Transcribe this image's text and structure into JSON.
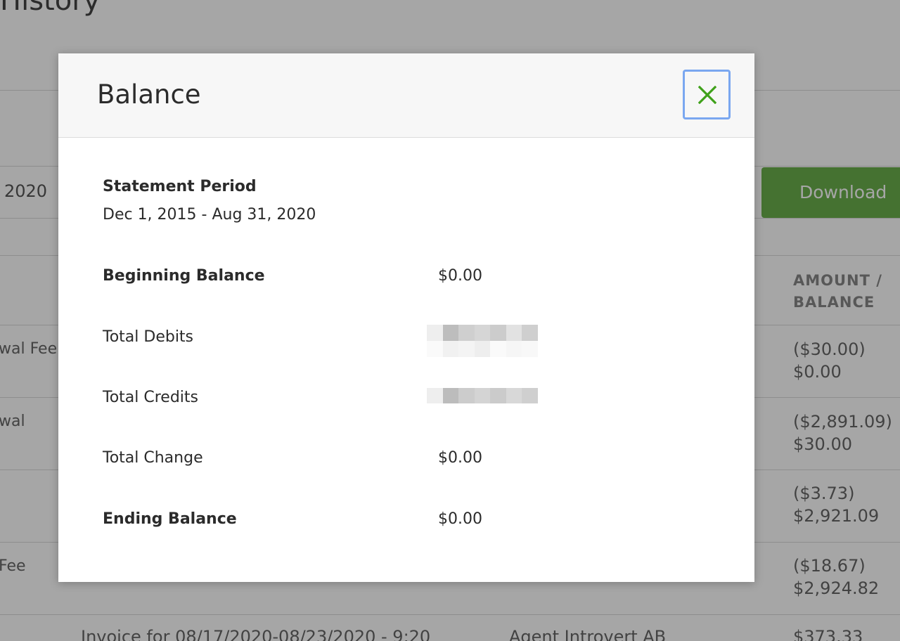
{
  "background": {
    "page_title": "History",
    "date_filter_text": "2020",
    "download_label": "Download",
    "column_header_amount": "AMOUNT /",
    "column_header_balance": "BALANCE",
    "rows": [
      {
        "left": "wal Fee",
        "amount": "($30.00)",
        "balance": "$0.00"
      },
      {
        "left": "wal",
        "amount": "($2,891.09)",
        "balance": "$30.00"
      },
      {
        "left": "",
        "amount": "($3.73)",
        "balance": "$2,921.09"
      },
      {
        "left": "Fee",
        "amount": "($18.67)",
        "balance": "$2,924.82"
      }
    ],
    "bottom_row": {
      "description": "Invoice for 08/17/2020-08/23/2020 - 9:20",
      "party": "Agent Introvert AB",
      "amount": "$373.33"
    }
  },
  "modal": {
    "title": "Balance",
    "close_icon": "close-icon",
    "statement_period_label": "Statement Period",
    "statement_period_value": "Dec 1, 2015 - Aug 31, 2020",
    "beginning_balance_label": "Beginning Balance",
    "beginning_balance_value": "$0.00",
    "total_debits_label": "Total Debits",
    "total_credits_label": "Total Credits",
    "total_change_label": "Total Change",
    "total_change_value": "$0.00",
    "ending_balance_label": "Ending Balance",
    "ending_balance_value": "$0.00"
  },
  "colors": {
    "close_icon": "#3fa11a",
    "close_focus_ring": "#7aa7f0",
    "download_button": "#6ab04c",
    "overlay": "rgba(0,0,0,0.35)"
  }
}
